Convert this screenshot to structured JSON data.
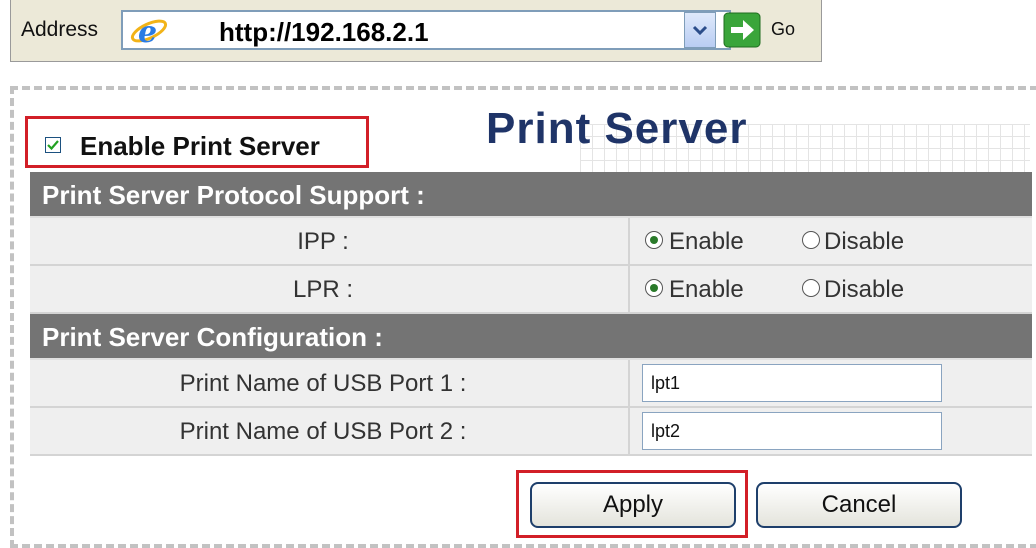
{
  "address_bar": {
    "label": "Address",
    "url": "http://192.168.2.1",
    "go_label": "Go"
  },
  "enable_print_server": {
    "label": "Enable Print Server",
    "checked": true
  },
  "page": {
    "title": "Print Server"
  },
  "protocol_section": {
    "header": "Print Server Protocol Support :",
    "rows": [
      {
        "label": "IPP :",
        "selected": "Enable",
        "enable_label": "Enable",
        "disable_label": "Disable"
      },
      {
        "label": "LPR :",
        "selected": "Enable",
        "enable_label": "Enable",
        "disable_label": "Disable"
      }
    ]
  },
  "config_section": {
    "header": "Print Server Configuration :",
    "rows": [
      {
        "label": "Print Name of USB Port 1 :",
        "value": "lpt1"
      },
      {
        "label": "Print Name of USB Port 2 :",
        "value": "lpt2"
      }
    ]
  },
  "buttons": {
    "apply": "Apply",
    "cancel": "Cancel"
  },
  "colors": {
    "highlight": "#d21f28",
    "title": "#1f3468",
    "section_header": "#747474"
  },
  "icons": [
    "ie-icon",
    "dropdown-arrow-icon",
    "go-arrow-icon",
    "checkbox-checked-icon"
  ]
}
